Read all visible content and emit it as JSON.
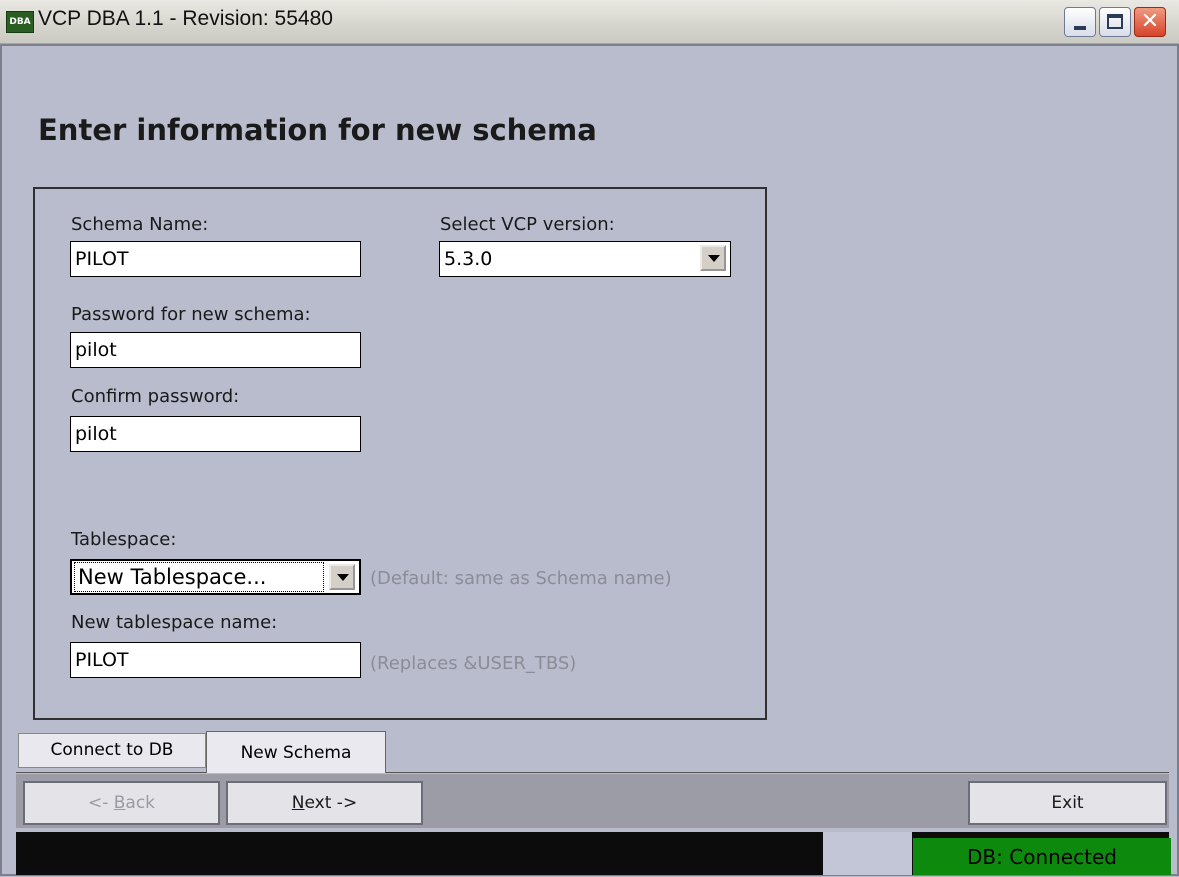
{
  "window": {
    "title": "VCP DBA 1.1 - Revision: 55480",
    "icon_label": "DBA",
    "buttons": {
      "minimize": "minimize-icon",
      "maximize": "maximize-icon",
      "close": "close-icon"
    }
  },
  "page": {
    "heading": "Enter information for new schema"
  },
  "form": {
    "schema_name_label": "Schema Name:",
    "schema_name_value": "PILOT",
    "vcp_version_label": "Select VCP version:",
    "vcp_version_value": "5.3.0",
    "password_label": "Password for new schema:",
    "password_value": "pilot",
    "confirm_label": "Confirm password:",
    "confirm_value": "pilot",
    "tablespace_label": "Tablespace:",
    "tablespace_value": "New Tablespace...",
    "tablespace_hint": "(Default: same as Schema name)",
    "new_tablespace_label": "New tablespace name:",
    "new_tablespace_value": "PILOT",
    "new_tablespace_hint": "(Replaces &USER_TBS)"
  },
  "tabs": [
    {
      "label": "Connect to DB",
      "active": false
    },
    {
      "label": "New Schema",
      "active": true
    }
  ],
  "buttons": {
    "back": {
      "prefix": "<- ",
      "mnemonic": "B",
      "rest": "ack",
      "enabled": false
    },
    "next": {
      "mnemonic": "N",
      "rest": "ext ->"
    },
    "exit": "Exit"
  },
  "status": {
    "db": "DB: Connected"
  },
  "colors": {
    "background": "#b9bccd",
    "status_ok": "#0d8a0d"
  }
}
